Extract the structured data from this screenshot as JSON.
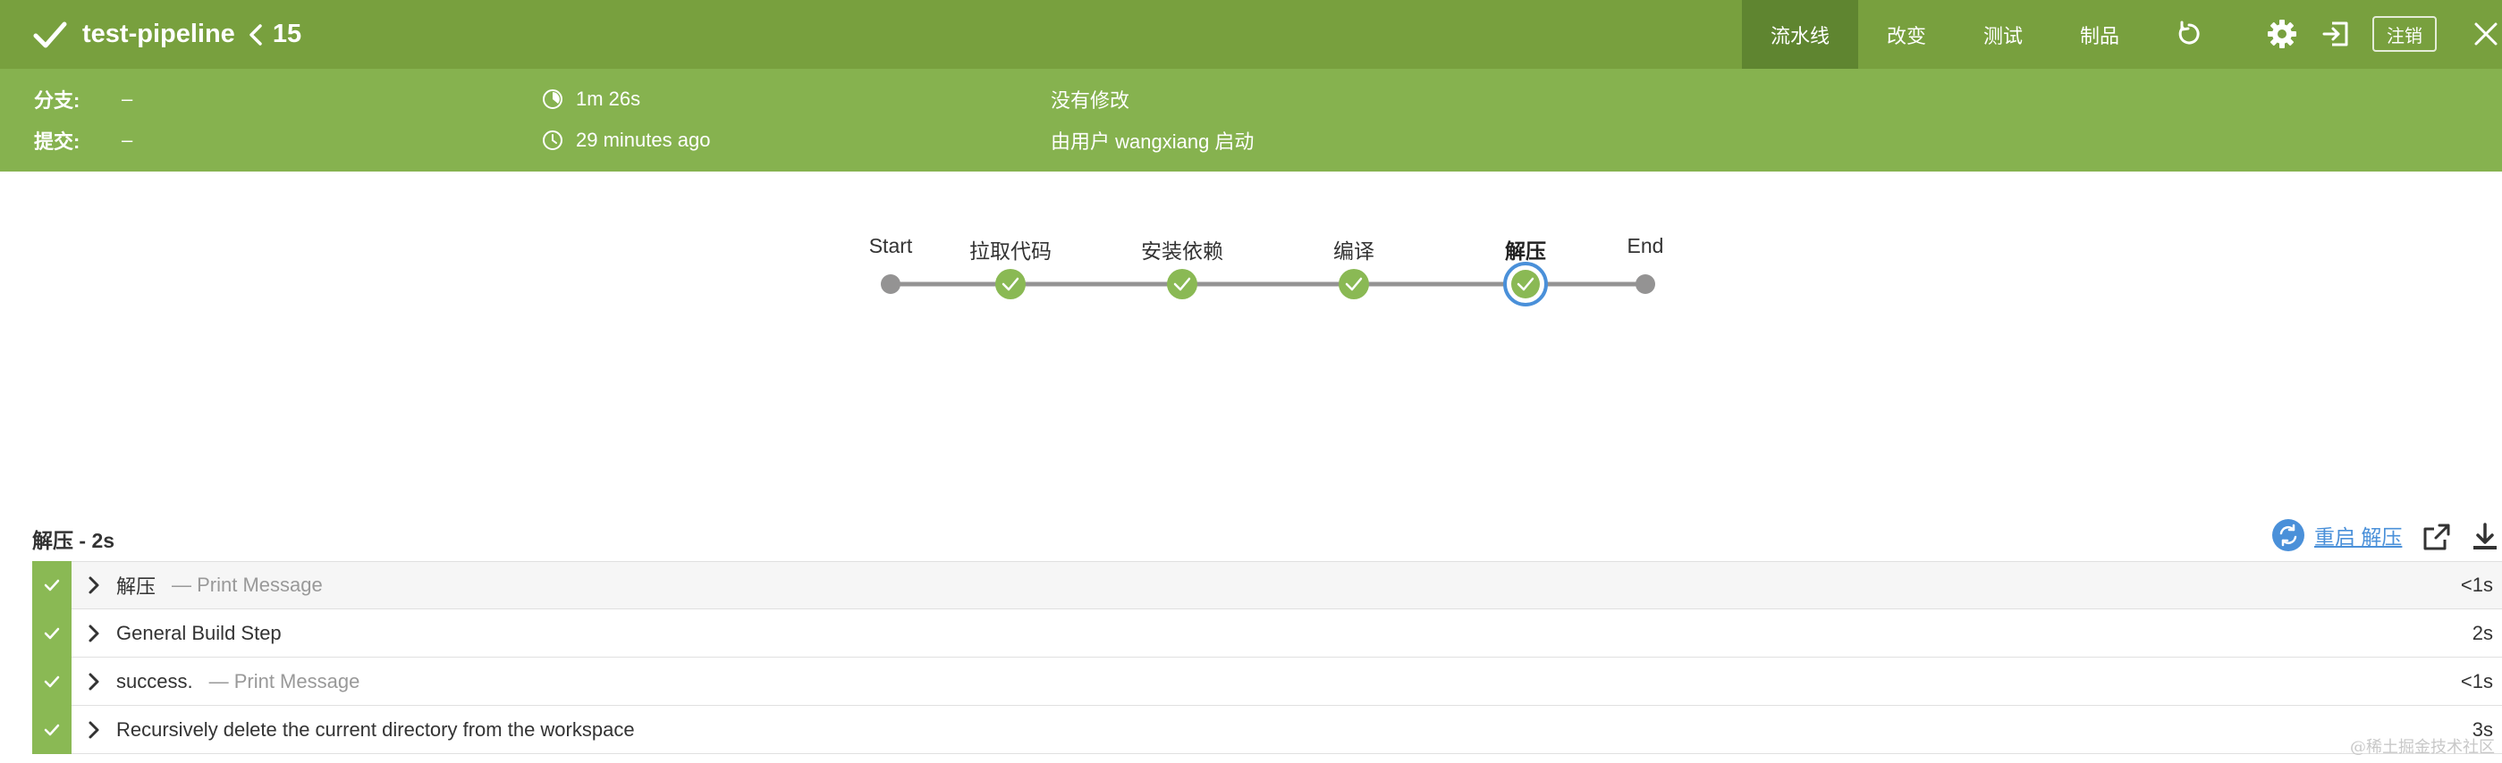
{
  "header": {
    "pipeline_name": "test-pipeline",
    "run_number": "15",
    "tabs": [
      {
        "label": "流水线",
        "active": true
      },
      {
        "label": "改变",
        "active": false
      },
      {
        "label": "测试",
        "active": false
      },
      {
        "label": "制品",
        "active": false
      }
    ],
    "logout_label": "注销",
    "colors": {
      "bar": "#78a03e",
      "active_tab": "#5f8530",
      "meta_bar": "#86b24f"
    }
  },
  "meta": {
    "branch_label": "分支:",
    "branch_value": "–",
    "commit_label": "提交:",
    "commit_value": "–",
    "duration": "1m 26s",
    "started_ago": "29 minutes ago",
    "changes": "没有修改",
    "started_by": "由用户 wangxiang 启动"
  },
  "graph": {
    "stages": [
      {
        "label": "Start",
        "status": "node"
      },
      {
        "label": "拉取代码",
        "status": "success"
      },
      {
        "label": "安装依赖",
        "status": "success"
      },
      {
        "label": "编译",
        "status": "success"
      },
      {
        "label": "解压",
        "status": "success",
        "selected": true
      },
      {
        "label": "End",
        "status": "node"
      }
    ]
  },
  "log": {
    "title": "解压 - 2s",
    "restart_label": "重启 解压",
    "steps": [
      {
        "name": "解压",
        "desc": "— Print Message",
        "time": "<1s"
      },
      {
        "name": "General Build Step",
        "desc": "",
        "time": "2s"
      },
      {
        "name": "success.",
        "desc": "— Print Message",
        "time": "<1s"
      },
      {
        "name": "Recursively delete the current directory from the workspace",
        "desc": "",
        "time": "3s"
      }
    ]
  },
  "watermark": "@稀土掘金技术社区"
}
